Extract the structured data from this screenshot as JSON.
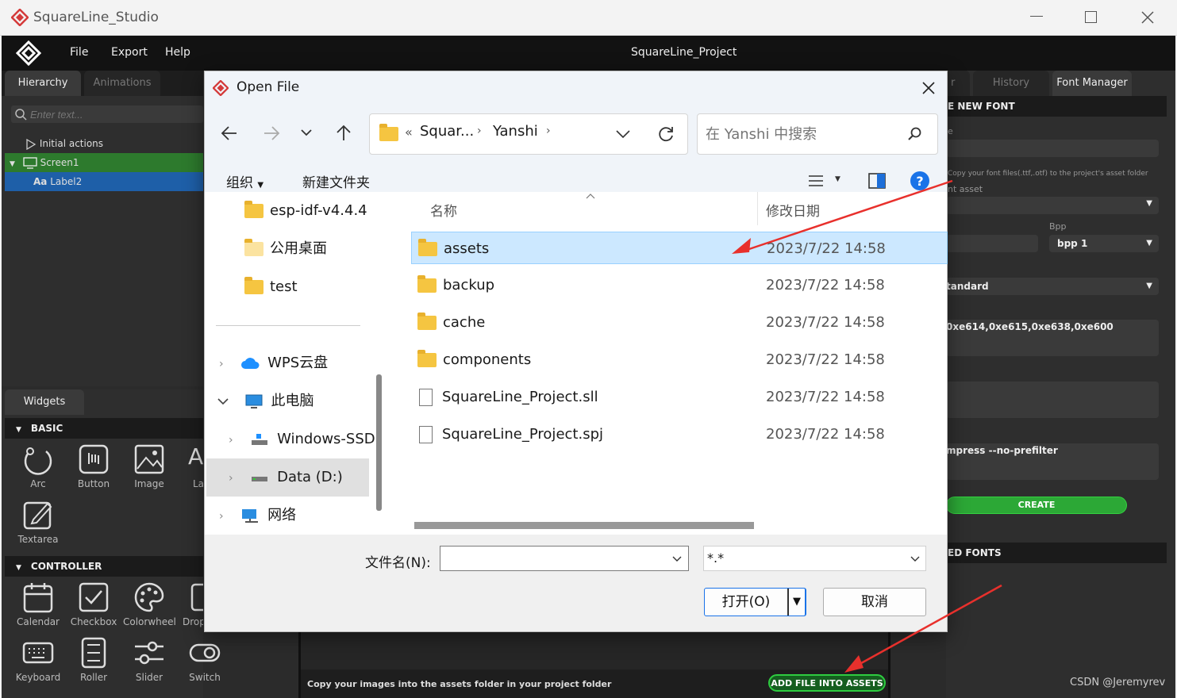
{
  "window": {
    "title": "SquareLine_Studio",
    "project_title": "SquareLine_Project"
  },
  "menu": [
    "File",
    "Export",
    "Help"
  ],
  "left_panel": {
    "tabs": [
      "Hierarchy",
      "Animations"
    ],
    "search_placeholder": "Enter text...",
    "tree": [
      "Initial actions",
      "Screen1",
      "Label2"
    ]
  },
  "widgets_panel": {
    "tab": "Widgets",
    "sections": [
      {
        "title": "BASIC",
        "items": [
          "Arc",
          "Button",
          "Image",
          "La",
          "Textarea"
        ]
      },
      {
        "title": "CONTROLLER",
        "items": [
          "Calendar",
          "Checkbox",
          "Colorwheel",
          "Drop",
          "Keyboard",
          "Roller",
          "Slider",
          "Switch"
        ]
      }
    ]
  },
  "right_panel": {
    "tabs": [
      "r",
      "History",
      "Font Manager"
    ],
    "new_font_header": "E NEW FONT",
    "name_label": "e",
    "hint": "Copy your font files(.ttf,.otf) to the project's asset folder",
    "asset_label": "nt asset",
    "bpp_label": "Bpp",
    "bpp_value": "bpp 1",
    "render_value": "tandard",
    "range_value": "0xe614,0xe615,0xe638,0xe600",
    "extra_value": "mpress --no-prefilter",
    "create_label": "CREATE",
    "loaded_header": "ED FONTS",
    "accent": "#2ecc40"
  },
  "assets_bar": {
    "text": "Copy your images into the assets folder in your project folder",
    "button": "ADD FILE INTO ASSETS"
  },
  "watermark": "CSDN @Jeremyrev",
  "dialog": {
    "title": "Open File",
    "breadcrumb": [
      "«",
      "Squar...",
      "Yanshi"
    ],
    "search_placeholder": "在 Yanshi 中搜索",
    "organize": "组织",
    "new_folder": "新建文件夹",
    "tree": [
      {
        "label": "esp-idf-v4.4.4",
        "icon": "folder"
      },
      {
        "label": "公用桌面",
        "icon": "folder"
      },
      {
        "label": "test",
        "icon": "folder"
      },
      {
        "label": "WPS云盘",
        "icon": "cloud"
      },
      {
        "label": "此电脑",
        "icon": "computer"
      },
      {
        "label": "Windows-SSD",
        "icon": "drive"
      },
      {
        "label": "Data (D:)",
        "icon": "drive"
      },
      {
        "label": "网络",
        "icon": "network"
      }
    ],
    "columns": {
      "name": "名称",
      "modified": "修改日期"
    },
    "files": [
      {
        "name": "assets",
        "date": "2023/7/22 14:58",
        "type": "folder"
      },
      {
        "name": "backup",
        "date": "2023/7/22 14:58",
        "type": "folder"
      },
      {
        "name": "cache",
        "date": "2023/7/22 14:58",
        "type": "folder"
      },
      {
        "name": "components",
        "date": "2023/7/22 14:58",
        "type": "folder"
      },
      {
        "name": "SquareLine_Project.sll",
        "date": "2023/7/22 14:58",
        "type": "file"
      },
      {
        "name": "SquareLine_Project.spj",
        "date": "2023/7/22 14:58",
        "type": "file"
      }
    ],
    "filename_label": "文件名(N):",
    "filename_value": "",
    "filter_value": "*.*",
    "open_label": "打开(O)",
    "cancel_label": "取消"
  }
}
